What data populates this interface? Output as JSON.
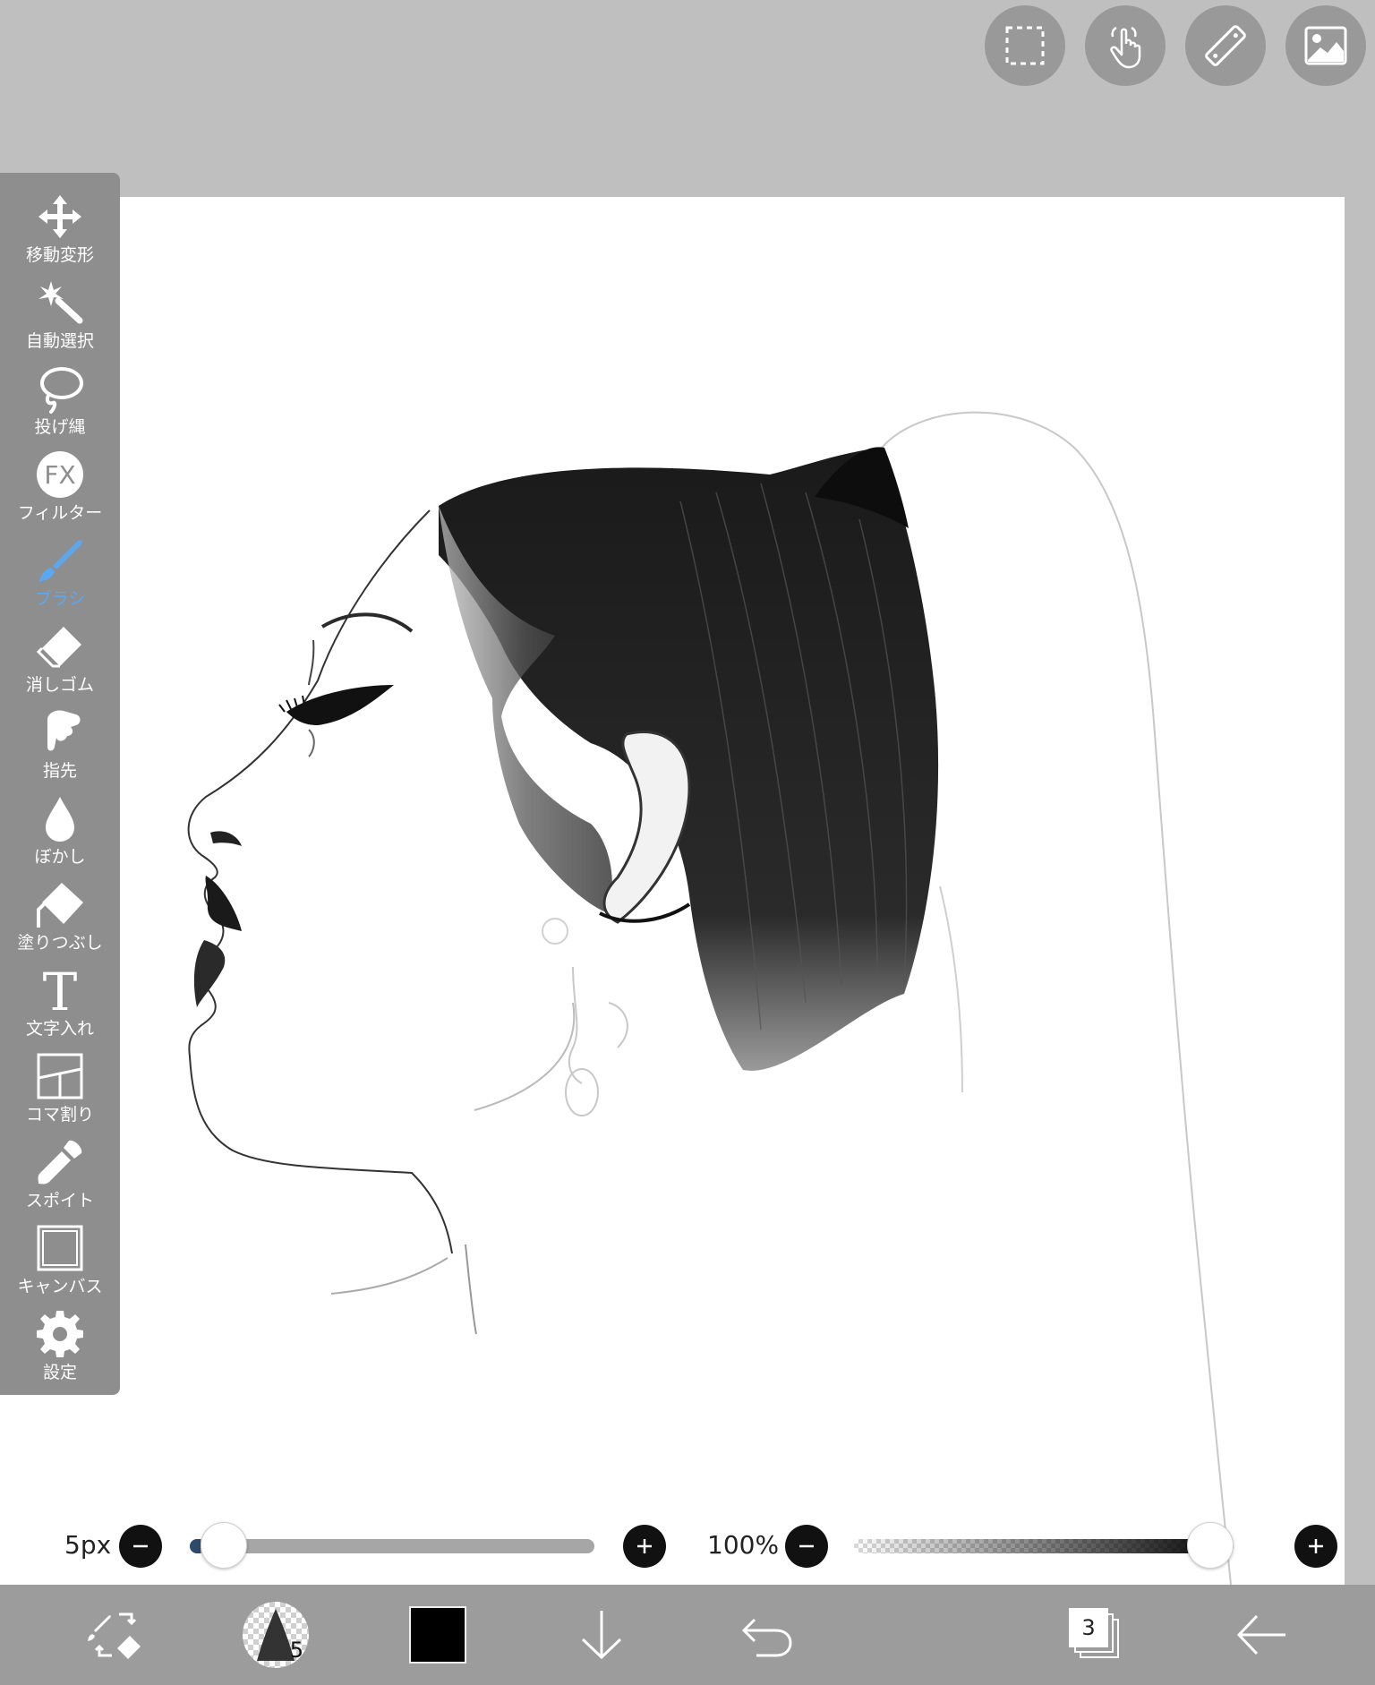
{
  "toolbar": {
    "tools": [
      {
        "label": "移動変形",
        "icon": "move-arrows-icon"
      },
      {
        "label": "自動選択",
        "icon": "magic-wand-icon"
      },
      {
        "label": "投げ縄",
        "icon": "lasso-icon"
      },
      {
        "label": "フィルター",
        "icon": "fx-icon",
        "icon_text": "FX"
      },
      {
        "label": "ブラシ",
        "icon": "brush-icon",
        "active": true
      },
      {
        "label": "消しゴム",
        "icon": "eraser-icon"
      },
      {
        "label": "指先",
        "icon": "finger-icon"
      },
      {
        "label": "ぼかし",
        "icon": "blur-drop-icon"
      },
      {
        "label": "塗りつぶし",
        "icon": "fill-bucket-icon"
      },
      {
        "label": "文字入れ",
        "icon": "text-t-icon",
        "icon_text": "T"
      },
      {
        "label": "コマ割り",
        "icon": "frame-divider-icon"
      },
      {
        "label": "スポイト",
        "icon": "eyedropper-icon"
      },
      {
        "label": "キャンバス",
        "icon": "canvas-square-icon"
      },
      {
        "label": "設定",
        "icon": "gear-icon"
      }
    ]
  },
  "top_buttons": [
    {
      "icon": "selection-rect-icon"
    },
    {
      "icon": "touch-gesture-icon"
    },
    {
      "icon": "ruler-icon"
    },
    {
      "icon": "material-image-icon"
    }
  ],
  "sliders": {
    "brush_size": {
      "value_label": "5px",
      "fraction": 0.03
    },
    "opacity": {
      "value_label": "100%",
      "fraction": 1.0
    }
  },
  "bottom_bar": {
    "brush_preview_size": "5",
    "current_color": "#000000",
    "layer_count": "3"
  },
  "colors": {
    "accent": "#5aa9f0",
    "toolbar_bg": "#8e8e8e",
    "background": "#bfbfbf"
  }
}
